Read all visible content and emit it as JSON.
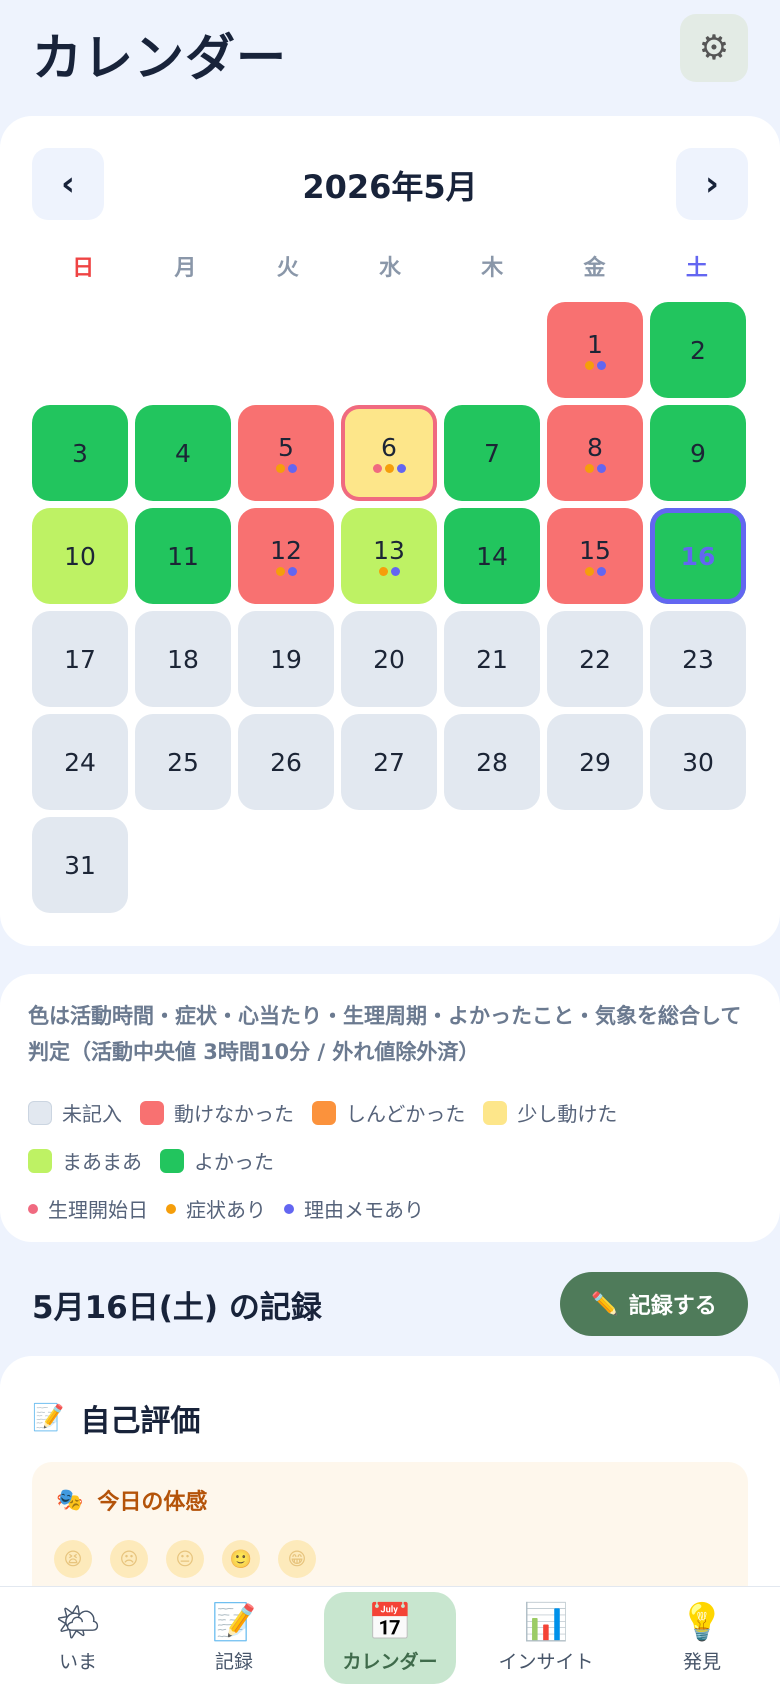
{
  "header": {
    "title": "カレンダー",
    "settings_icon": "gear-icon"
  },
  "calendar": {
    "month_title": "2026年5月",
    "prev_label": "‹",
    "next_label": "›",
    "weekdays": [
      "日",
      "月",
      "火",
      "水",
      "木",
      "金",
      "土"
    ],
    "lead_blanks": 5,
    "days": [
      {
        "d": "1",
        "level": "bad",
        "dots": [
          "orange",
          "purple"
        ]
      },
      {
        "d": "2",
        "level": "good",
        "dots": []
      },
      {
        "d": "3",
        "level": "good",
        "dots": []
      },
      {
        "d": "4",
        "level": "good",
        "dots": []
      },
      {
        "d": "5",
        "level": "bad",
        "dots": [
          "orange",
          "purple"
        ]
      },
      {
        "d": "6",
        "level": "little",
        "dots": [
          "pink",
          "orange",
          "purple"
        ],
        "outline": true
      },
      {
        "d": "7",
        "level": "good",
        "dots": []
      },
      {
        "d": "8",
        "level": "bad",
        "dots": [
          "orange",
          "purple"
        ]
      },
      {
        "d": "9",
        "level": "good",
        "dots": []
      },
      {
        "d": "10",
        "level": "ok",
        "dots": []
      },
      {
        "d": "11",
        "level": "good",
        "dots": []
      },
      {
        "d": "12",
        "level": "bad",
        "dots": [
          "orange",
          "purple"
        ]
      },
      {
        "d": "13",
        "level": "ok",
        "dots": [
          "orange",
          "purple"
        ]
      },
      {
        "d": "14",
        "level": "good",
        "dots": []
      },
      {
        "d": "15",
        "level": "bad",
        "dots": [
          "orange",
          "purple"
        ]
      },
      {
        "d": "16",
        "level": "good",
        "dots": [],
        "selected": true
      },
      {
        "d": "17",
        "level": "none",
        "dots": []
      },
      {
        "d": "18",
        "level": "none",
        "dots": []
      },
      {
        "d": "19",
        "level": "none",
        "dots": []
      },
      {
        "d": "20",
        "level": "none",
        "dots": []
      },
      {
        "d": "21",
        "level": "none",
        "dots": []
      },
      {
        "d": "22",
        "level": "none",
        "dots": []
      },
      {
        "d": "23",
        "level": "none",
        "dots": []
      },
      {
        "d": "24",
        "level": "none",
        "dots": []
      },
      {
        "d": "25",
        "level": "none",
        "dots": []
      },
      {
        "d": "26",
        "level": "none",
        "dots": []
      },
      {
        "d": "27",
        "level": "none",
        "dots": []
      },
      {
        "d": "28",
        "level": "none",
        "dots": []
      },
      {
        "d": "29",
        "level": "none",
        "dots": []
      },
      {
        "d": "30",
        "level": "none",
        "dots": []
      },
      {
        "d": "31",
        "level": "none",
        "dots": []
      }
    ]
  },
  "colors": {
    "none": "#e2e8f0",
    "bad": "#f87171",
    "hard": "#fb923c",
    "little": "#fde68a",
    "ok": "#bef264",
    "good": "#22c55e",
    "pink": "#f06a80",
    "orange": "#f59e0b",
    "purple": "#6366f1"
  },
  "legend": {
    "description": "色は活動時間・症状・心当たり・生理周期・よかったこと・気象を総合して判定（活動中央値 3時間10分 / 外れ値除外済）",
    "levels": [
      {
        "key": "none",
        "label": "未記入"
      },
      {
        "key": "bad",
        "label": "動けなかった"
      },
      {
        "key": "hard",
        "label": "しんどかった"
      },
      {
        "key": "little",
        "label": "少し動けた"
      },
      {
        "key": "ok",
        "label": "まあまあ"
      },
      {
        "key": "good",
        "label": "よかった"
      }
    ],
    "dots": [
      {
        "key": "pink",
        "label": "生理開始日"
      },
      {
        "key": "orange",
        "label": "症状あり"
      },
      {
        "key": "purple",
        "label": "理由メモあり"
      }
    ]
  },
  "record": {
    "title": "5月16日(土) の記録",
    "button_label": "記録する",
    "button_icon": "pencil-icon"
  },
  "self_eval": {
    "title": "自己評価",
    "icon": "memo-icon",
    "mood_label": "今日の体感",
    "mood_icon": "mask-icon",
    "faces": [
      "😫",
      "☹",
      "😐",
      "🙂",
      "😁"
    ]
  },
  "tabs": [
    {
      "label": "いま",
      "icon": "🌤",
      "icon_name": "weather-icon",
      "active": false
    },
    {
      "label": "記録",
      "icon": "📝",
      "icon_name": "memo-icon",
      "active": false
    },
    {
      "label": "カレンダー",
      "icon": "📅",
      "icon_name": "calendar-icon",
      "active": true
    },
    {
      "label": "インサイト",
      "icon": "📊",
      "icon_name": "chart-icon",
      "active": false
    },
    {
      "label": "発見",
      "icon": "💡",
      "icon_name": "lightbulb-icon",
      "active": false
    }
  ]
}
